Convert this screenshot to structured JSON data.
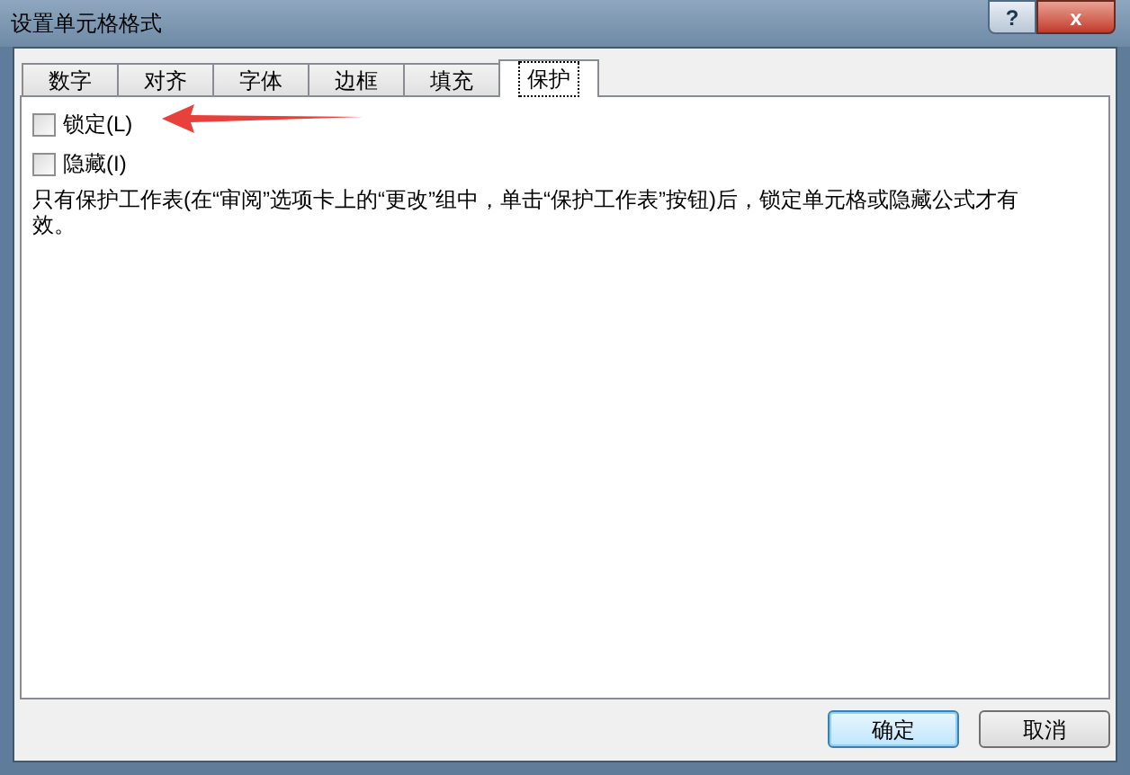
{
  "window": {
    "title": "设置单元格格式",
    "help_button": "?",
    "close_button": "x"
  },
  "tabs": [
    {
      "label": "数字",
      "selected": false
    },
    {
      "label": "对齐",
      "selected": false
    },
    {
      "label": "字体",
      "selected": false
    },
    {
      "label": "边框",
      "selected": false
    },
    {
      "label": "填充",
      "selected": false
    },
    {
      "label": "保护",
      "selected": true
    }
  ],
  "options": [
    {
      "label": "锁定(L)",
      "checked": false
    },
    {
      "label": "隐藏(I)",
      "checked": false
    }
  ],
  "note": "只有保护工作表(在“审阅”选项卡上的“更改”组中，单击“保护工作表”按钮)后，锁定单元格或隐藏公式才有效。",
  "buttons": [
    {
      "label": "确定",
      "default": true
    },
    {
      "label": "取消",
      "default": false
    }
  ]
}
